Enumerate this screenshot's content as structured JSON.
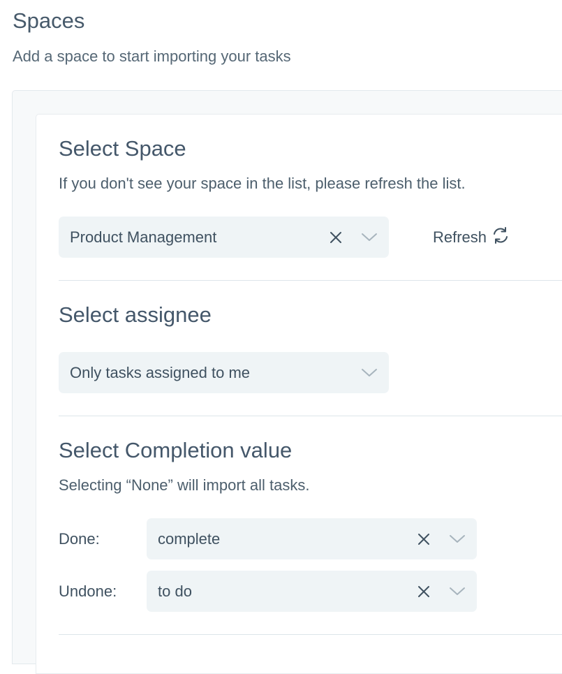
{
  "header": {
    "title": "Spaces",
    "subtitle": "Add a space to start importing your tasks"
  },
  "space_section": {
    "title": "Select Space",
    "description": "If you don't see your space in the list, please refresh the list.",
    "select_value": "Product Management",
    "refresh_label": "Refresh"
  },
  "assignee_section": {
    "title": "Select assignee",
    "select_value": "Only tasks assigned to me"
  },
  "completion_section": {
    "title": "Select Completion value",
    "description": "Selecting “None” will import all tasks.",
    "done_label": "Done:",
    "done_value": "complete",
    "undone_label": "Undone:",
    "undone_value": "to do"
  },
  "icons": {
    "clear": "close-icon",
    "dropdown": "chevron-down-icon",
    "refresh": "refresh-icon"
  },
  "colors": {
    "select_background": "#eff4f6",
    "text": "#3f5160",
    "divider": "#dde5ea"
  }
}
